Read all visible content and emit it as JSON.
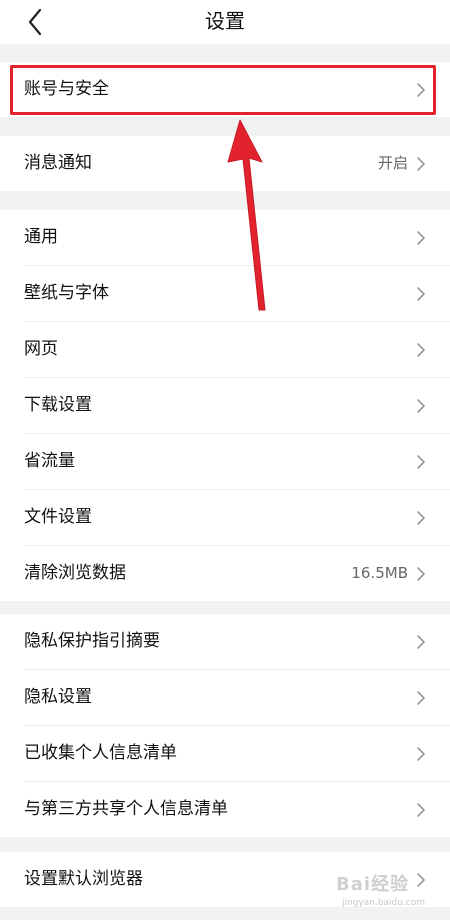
{
  "header": {
    "title": "设置",
    "back_icon": "chevron-left-icon"
  },
  "groups": [
    {
      "items": [
        {
          "label": "账号与安全",
          "value": ""
        }
      ]
    },
    {
      "items": [
        {
          "label": "消息通知",
          "value": "开启"
        }
      ]
    },
    {
      "items": [
        {
          "label": "通用",
          "value": ""
        },
        {
          "label": "壁纸与字体",
          "value": ""
        },
        {
          "label": "网页",
          "value": ""
        },
        {
          "label": "下载设置",
          "value": ""
        },
        {
          "label": "省流量",
          "value": ""
        },
        {
          "label": "文件设置",
          "value": ""
        },
        {
          "label": "清除浏览数据",
          "value": "16.5MB"
        }
      ]
    },
    {
      "items": [
        {
          "label": "隐私保护指引摘要",
          "value": ""
        },
        {
          "label": "隐私设置",
          "value": ""
        },
        {
          "label": "已收集个人信息清单",
          "value": ""
        },
        {
          "label": "与第三方共享个人信息清单",
          "value": ""
        }
      ]
    },
    {
      "items": [
        {
          "label": "设置默认浏览器",
          "value": ""
        }
      ]
    }
  ],
  "annotation": {
    "highlight_color": "#e2232e",
    "target": "账号与安全"
  },
  "watermark": {
    "brand": "Bai经验",
    "url": "jingyan.baidu.com"
  },
  "colors": {
    "background": "#f2f2f2",
    "card": "#ffffff",
    "text": "#111111",
    "secondary": "#666666",
    "chevron": "#9a9a9a"
  }
}
